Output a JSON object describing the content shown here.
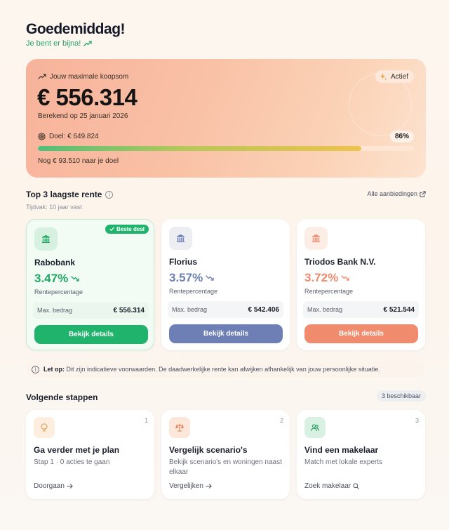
{
  "header": {
    "greeting": "Goedemiddag!",
    "subtitle": "Je bent er bijna!"
  },
  "hero": {
    "label": "Jouw maximale koopsom",
    "status_badge": "Actief",
    "amount": "€ 556.314",
    "calculated_on": "Berekend op 25 januari 2026",
    "goal": "Doel: € 649.824",
    "progress_percent_label": "86%",
    "progress_fraction": 0.86,
    "remaining": "Nog € 93.510 naar je doel"
  },
  "rates_section": {
    "title": "Top 3 laagste rente",
    "info_glyph": "i",
    "all_offers_link": "Alle aanbiedingen",
    "period": "Tijdvak: 10 jaar vast",
    "best_badge": "Beste deal",
    "banks": [
      {
        "name": "Rabobank",
        "rate": "3.47%",
        "rate_label": "Rentepercentage",
        "max_label": "Max. bedrag",
        "max_value": "€ 556.314",
        "button": "Bekijk details",
        "accent": "#1fb36b",
        "rate_color": "#1fa866",
        "icon_bg": "#d7f1e1",
        "icon": "bank-icon"
      },
      {
        "name": "Florius",
        "rate": "3.57%",
        "rate_label": "Rentepercentage",
        "max_label": "Max. bedrag",
        "max_value": "€ 542.406",
        "button": "Bekijk details",
        "accent": "#6d7fb5",
        "rate_color": "#6d7fb5",
        "icon_bg": "#eceef2",
        "icon": "bank-icon"
      },
      {
        "name": "Triodos Bank N.V.",
        "rate": "3.72%",
        "rate_label": "Rentepercentage",
        "max_label": "Max. bedrag",
        "max_value": "€ 521.544",
        "button": "Bekijk details",
        "accent": "#f08b6e",
        "rate_color": "#f08b6e",
        "icon_bg": "#fdeee5",
        "icon": "bank-icon"
      }
    ]
  },
  "note": {
    "info_glyph": "i",
    "prefix": "Let op:",
    "text": "Dit zijn indicatieve voorwaarden. De daadwerkelijke rente kan afwijken afhankelijk van jouw persoonlijke situatie."
  },
  "steps_section": {
    "title": "Volgende stappen",
    "available_badge": "3 beschikbaar",
    "steps": [
      {
        "number": "1",
        "title": "Ga verder met je plan",
        "description": "Stap 1 · 0 acties te gaan",
        "link": "Doorgaan",
        "icon": "lightbulb-icon",
        "icon_bg": "#fdeee0",
        "icon_color": "#e59a52"
      },
      {
        "number": "2",
        "title": "Vergelijk scenario's",
        "description": "Bekijk scenario's en woningen naast elkaar",
        "link": "Vergelijken",
        "icon": "scale-icon",
        "icon_bg": "#fde6da",
        "icon_color": "#e07b52"
      },
      {
        "number": "3",
        "title": "Vind een makelaar",
        "description": "Match met lokale experts",
        "link": "Zoek makelaar",
        "icon": "users-icon",
        "icon_bg": "#d9f1e2",
        "icon_color": "#1f9d5e"
      }
    ]
  }
}
